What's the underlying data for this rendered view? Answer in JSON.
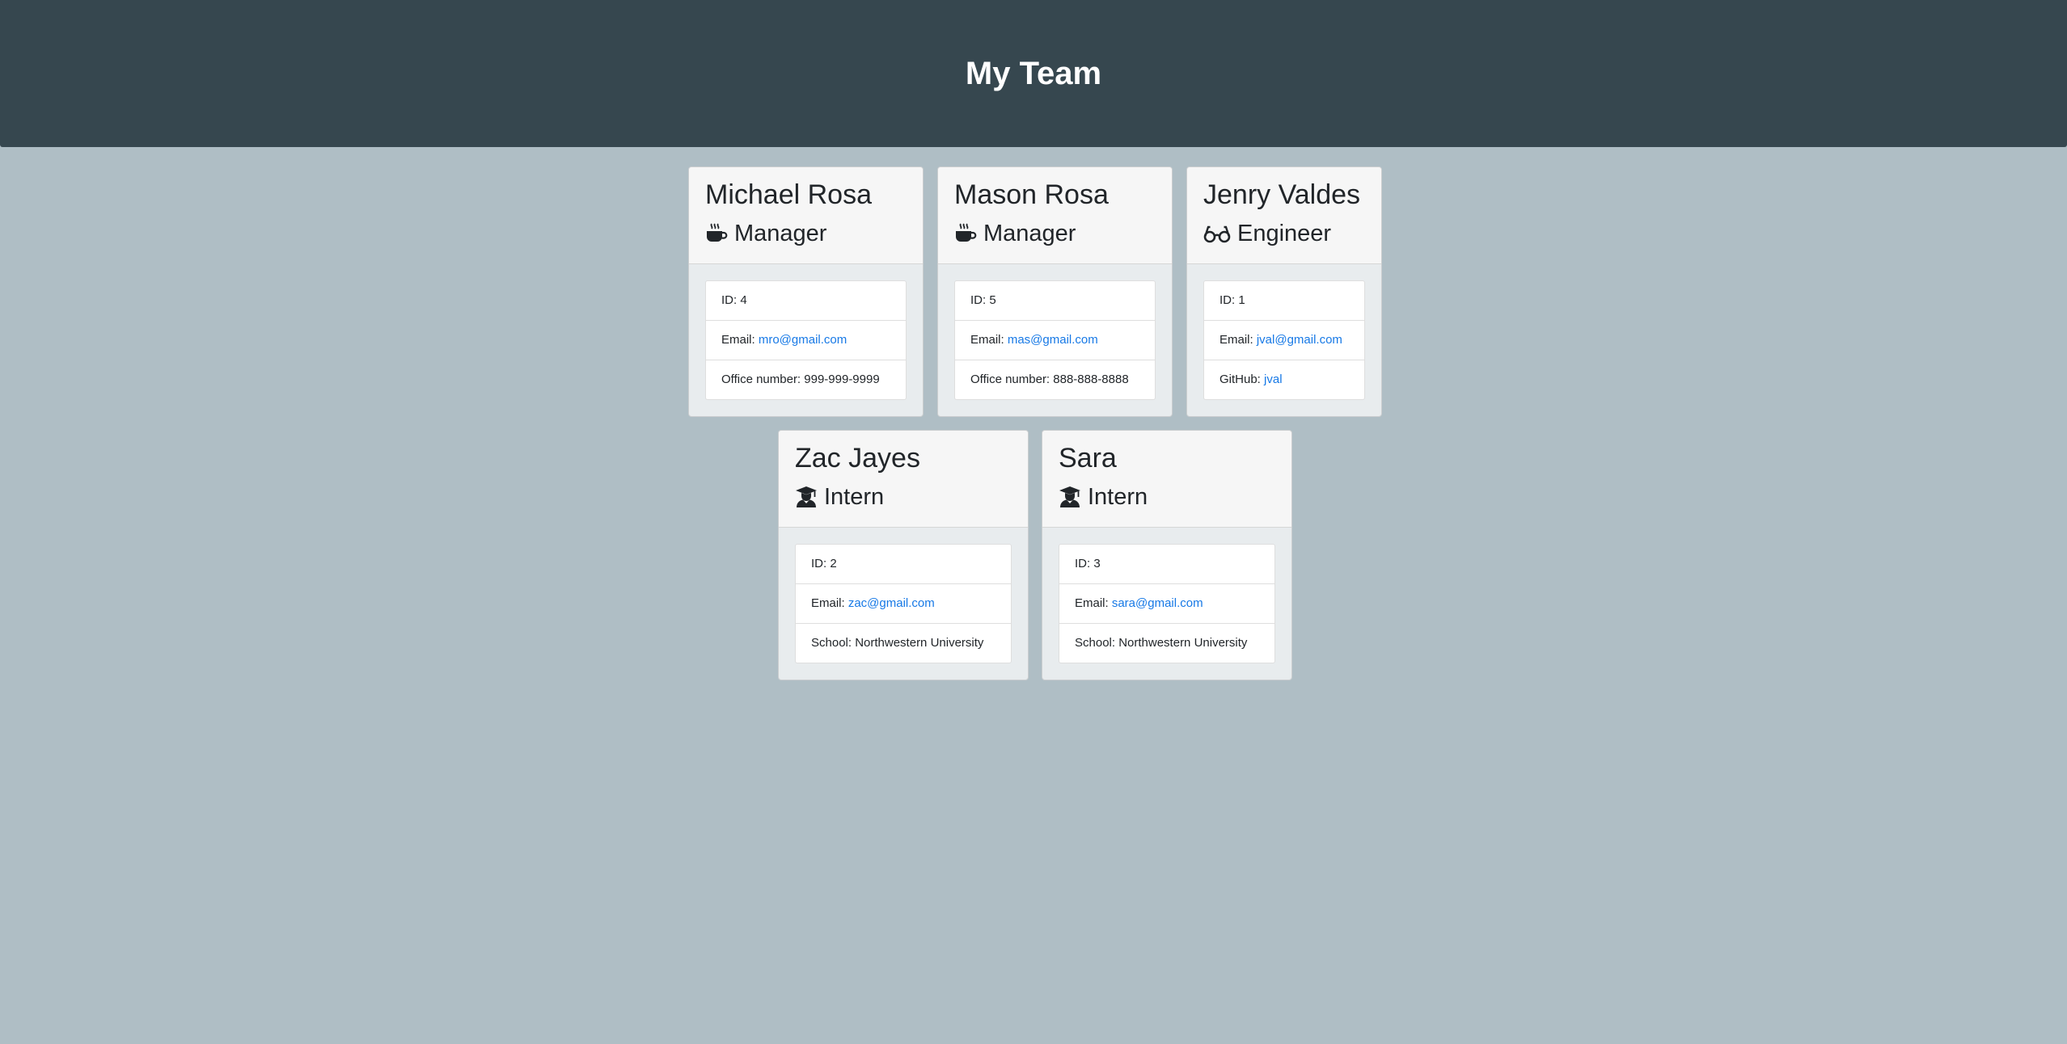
{
  "header": {
    "title": "My Team"
  },
  "employees": [
    {
      "name": "Michael Rosa",
      "role": "Manager",
      "icon": "coffee-icon",
      "id_label": "ID: 4",
      "email_label": "Email: ",
      "email": "mro@gmail.com",
      "extra_label": "Office number: 999-999-9999"
    },
    {
      "name": "Mason Rosa",
      "role": "Manager",
      "icon": "coffee-icon",
      "id_label": "ID: 5",
      "email_label": "Email: ",
      "email": "mas@gmail.com",
      "extra_label": "Office number: 888-888-8888"
    },
    {
      "name": "Jenry Valdes",
      "role": "Engineer",
      "icon": "glasses-icon",
      "id_label": "ID: 1",
      "email_label": "Email: ",
      "email": "jval@gmail.com",
      "extra_prefix": "GitHub: ",
      "extra_link": "jval"
    },
    {
      "name": "Zac Jayes",
      "role": "Intern",
      "icon": "graduate-icon",
      "id_label": "ID: 2",
      "email_label": "Email: ",
      "email": "zac@gmail.com",
      "extra_label": "School: Northwestern University"
    },
    {
      "name": "Sara",
      "role": "Intern",
      "icon": "graduate-icon",
      "id_label": "ID: 3",
      "email_label": "Email: ",
      "email": "sara@gmail.com",
      "extra_label": "School: Northwestern University"
    }
  ],
  "colors": {
    "header_bg": "#36474f",
    "page_bg": "#afbec5",
    "link": "#1779e6"
  }
}
